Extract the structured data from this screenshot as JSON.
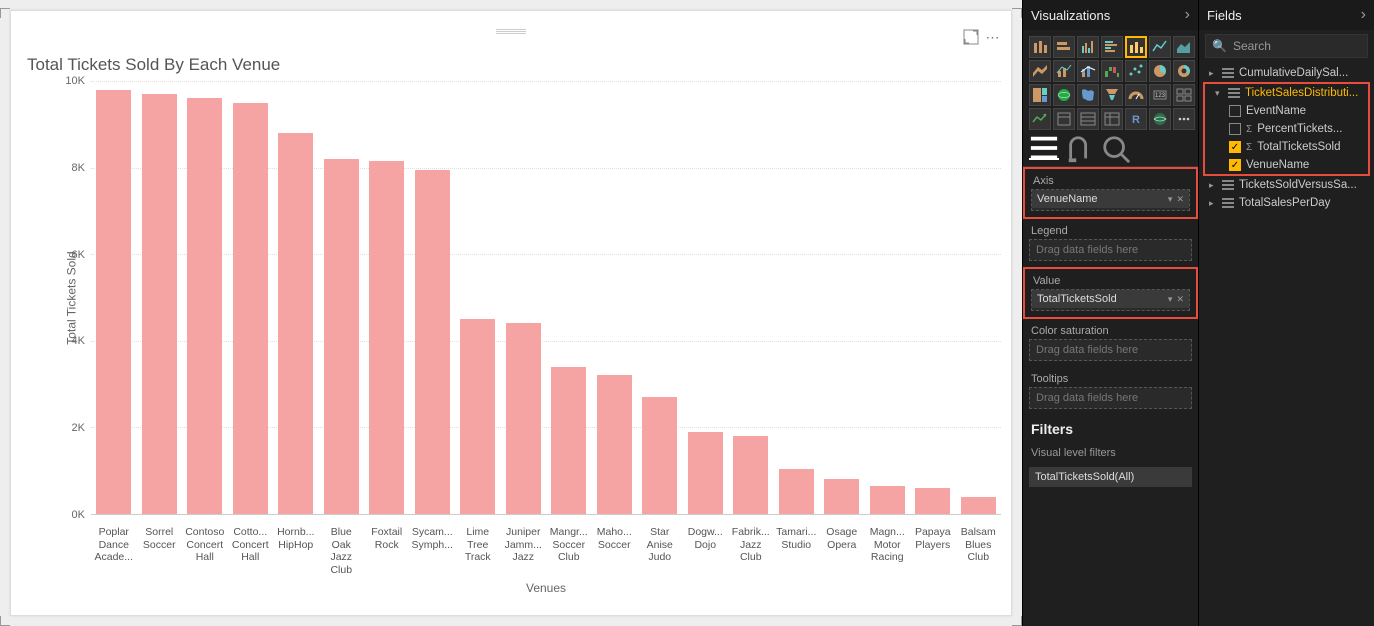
{
  "panels": {
    "visualizations_title": "Visualizations",
    "fields_title": "Fields",
    "search_placeholder": "Search"
  },
  "chart_data": {
    "type": "bar",
    "title": "Total Tickets Sold By Each Venue",
    "xlabel": "Venues",
    "ylabel": "Total Tickets Sold",
    "ylim": [
      0,
      10000
    ],
    "y_ticks": [
      "0K",
      "2K",
      "4K",
      "6K",
      "8K",
      "10K"
    ],
    "categories": [
      "Poplar Dance Acade...",
      "Sorrel Soccer",
      "Contoso Concert Hall",
      "Cotto... Concert Hall",
      "Hornb... HipHop",
      "Blue Oak Jazz Club",
      "Foxtail Rock",
      "Sycam... Symph...",
      "Lime Tree Track",
      "Juniper Jamm... Jazz",
      "Mangr... Soccer Club",
      "Maho... Soccer",
      "Star Anise Judo",
      "Dogw... Dojo",
      "Fabrik... Jazz Club",
      "Tamari... Studio",
      "Osage Opera",
      "Magn... Motor Racing",
      "Papaya Players",
      "Balsam Blues Club"
    ],
    "values": [
      9800,
      9700,
      9600,
      9500,
      8800,
      8200,
      8150,
      7950,
      4500,
      4400,
      3400,
      3200,
      2700,
      1900,
      1800,
      1050,
      800,
      650,
      600,
      400
    ]
  },
  "sections": {
    "axis_label": "Axis",
    "axis_value": "VenueName",
    "legend_label": "Legend",
    "legend_placeholder": "Drag data fields here",
    "value_label": "Value",
    "value_value": "TotalTicketsSold",
    "color_sat_label": "Color saturation",
    "color_sat_placeholder": "Drag data fields here",
    "tooltips_label": "Tooltips",
    "tooltips_placeholder": "Drag data fields here",
    "filters_label": "Filters",
    "filters_sub": "Visual level filters",
    "filter_item": "TotalTicketsSold(All)"
  },
  "fields_tree": {
    "tables": [
      {
        "name": "CumulativeDailySal...",
        "expanded": false
      },
      {
        "name": "TicketSalesDistributi...",
        "expanded": true,
        "highlight": true,
        "fields": [
          {
            "name": "EventName",
            "checked": false,
            "sigma": false
          },
          {
            "name": "PercentTickets...",
            "checked": false,
            "sigma": true
          },
          {
            "name": "TotalTicketsSold",
            "checked": true,
            "sigma": true
          },
          {
            "name": "VenueName",
            "checked": true,
            "sigma": false
          }
        ]
      },
      {
        "name": "TicketsSoldVersusSa...",
        "expanded": false
      },
      {
        "name": "TotalSalesPerDay",
        "expanded": false
      }
    ]
  }
}
